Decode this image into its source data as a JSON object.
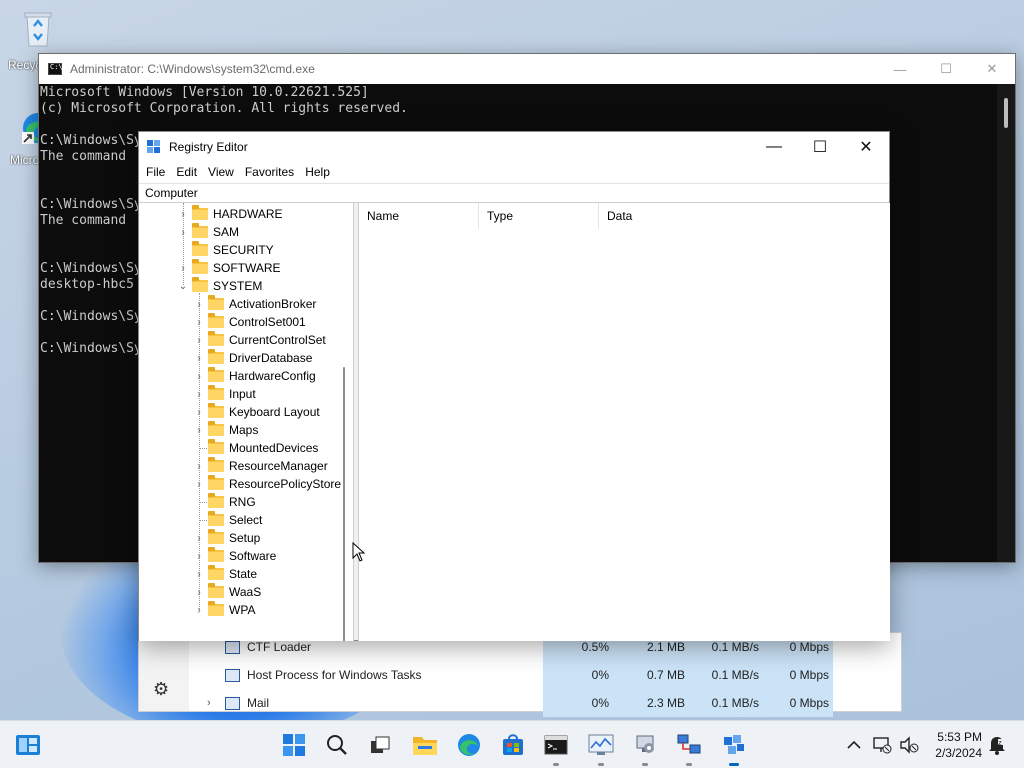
{
  "desktop": {
    "icons": [
      {
        "label": "Recycle Bin",
        "icon": "recycle-bin-icon"
      },
      {
        "label": "Microsoft Edge",
        "icon": "edge-icon"
      }
    ]
  },
  "cmd": {
    "title": "Administrator: C:\\Windows\\system32\\cmd.exe",
    "lines": [
      "Microsoft Windows [Version 10.0.22621.525]",
      "(c) Microsoft Corporation. All rights reserved.",
      "",
      "C:\\Windows\\Sy",
      "The command ",
      "",
      "",
      "C:\\Windows\\Sy",
      "The command ",
      "",
      "",
      "C:\\Windows\\Sy",
      "desktop-hbc5",
      "",
      "C:\\Windows\\Sy",
      "",
      "C:\\Windows\\Sy"
    ],
    "buttons": {
      "minimize": "—",
      "maximize": "☐",
      "close": "✕"
    }
  },
  "regedit": {
    "title": "Registry Editor",
    "menu": [
      "File",
      "Edit",
      "View",
      "Favorites",
      "Help"
    ],
    "address": "Computer",
    "tree_top": [
      {
        "label": "HARDWARE",
        "expander": "›"
      },
      {
        "label": "SAM",
        "expander": "›"
      },
      {
        "label": "SECURITY",
        "expander": ""
      },
      {
        "label": "SOFTWARE",
        "expander": "›"
      },
      {
        "label": "SYSTEM",
        "expander": "⌄"
      }
    ],
    "tree_system_children": [
      {
        "label": "ActivationBroker",
        "expander": "›"
      },
      {
        "label": "ControlSet001",
        "expander": "›"
      },
      {
        "label": "CurrentControlSet",
        "expander": "›"
      },
      {
        "label": "DriverDatabase",
        "expander": "›"
      },
      {
        "label": "HardwareConfig",
        "expander": "›"
      },
      {
        "label": "Input",
        "expander": "›"
      },
      {
        "label": "Keyboard Layout",
        "expander": "›"
      },
      {
        "label": "Maps",
        "expander": "›"
      },
      {
        "label": "MountedDevices",
        "expander": ""
      },
      {
        "label": "ResourceManager",
        "expander": "›"
      },
      {
        "label": "ResourcePolicyStore",
        "expander": "›"
      },
      {
        "label": "RNG",
        "expander": ""
      },
      {
        "label": "Select",
        "expander": ""
      },
      {
        "label": "Setup",
        "expander": "›"
      },
      {
        "label": "Software",
        "expander": "›"
      },
      {
        "label": "State",
        "expander": "›"
      },
      {
        "label": "WaaS",
        "expander": "›"
      },
      {
        "label": "WPA",
        "expander": "›"
      }
    ],
    "columns": [
      "Name",
      "Type",
      "Data"
    ],
    "buttons": {
      "minimize": "—",
      "maximize": "☐",
      "close": "✕"
    }
  },
  "taskmgr": {
    "rows": [
      {
        "name": "CTF Loader",
        "cpu": "0.5%",
        "memory": "2.1 MB",
        "disk": "0.1 MB/s",
        "network": "0 Mbps",
        "expander": ""
      },
      {
        "name": "Host Process for Windows Tasks",
        "cpu": "0%",
        "memory": "0.7 MB",
        "disk": "0.1 MB/s",
        "network": "0 Mbps",
        "expander": ""
      },
      {
        "name": "Mail",
        "cpu": "0%",
        "memory": "2.3 MB",
        "disk": "0.1 MB/s",
        "network": "0 Mbps",
        "expander": "›"
      }
    ],
    "settings_icon": "gear-icon"
  },
  "taskbar": {
    "apps": [
      "start-icon",
      "search-icon",
      "task-view-icon",
      "file-explorer-icon",
      "edge-icon",
      "store-icon",
      "terminal-icon",
      "performance-monitor-icon",
      "computer-management-icon",
      "network-icon",
      "registry-editor-icon"
    ],
    "time": "5:53 PM",
    "date": "2/3/2024",
    "accent": "#0067c0"
  }
}
